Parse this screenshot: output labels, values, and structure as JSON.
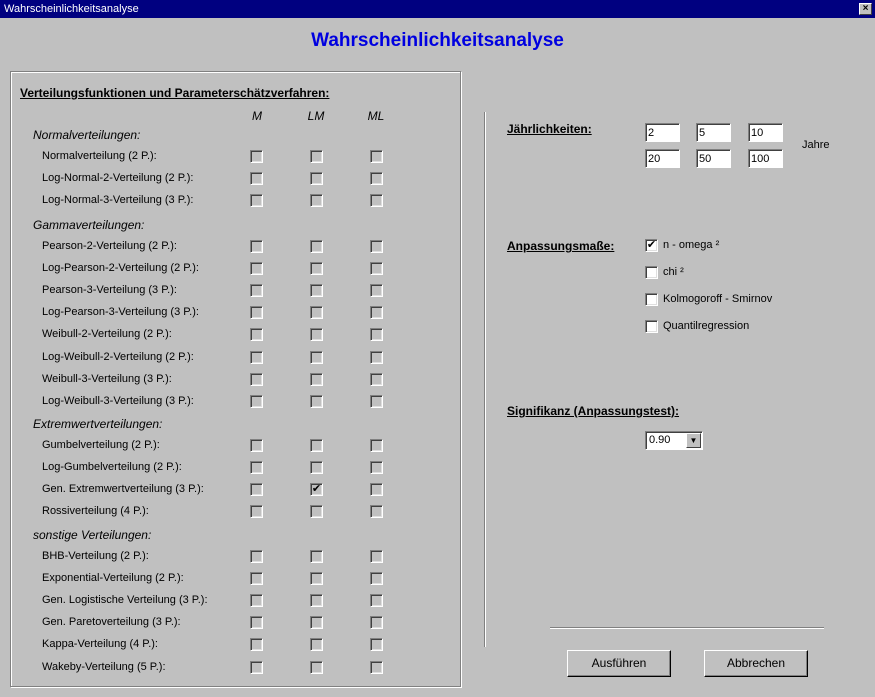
{
  "window": {
    "title": "Wahrscheinlichkeitsanalyse",
    "close_glyph": "×"
  },
  "header": {
    "title": "Wahrscheinlichkeitsanalyse"
  },
  "left": {
    "heading": "Verteilungsfunktionen und Parameterschätzverfahren:",
    "columns": [
      "M",
      "LM",
      "ML"
    ],
    "groups": [
      {
        "label": "Normalverteilungen:",
        "items": [
          {
            "label": "Normalverteilung (2 P.):",
            "checks": [
              false,
              false,
              false
            ]
          },
          {
            "label": "Log-Normal-2-Verteilung (2 P.):",
            "checks": [
              false,
              false,
              false
            ]
          },
          {
            "label": "Log-Normal-3-Verteilung (3 P.):",
            "checks": [
              false,
              false,
              false
            ]
          }
        ]
      },
      {
        "label": "Gammaverteilungen:",
        "items": [
          {
            "label": "Pearson-2-Verteilung (2 P.):",
            "checks": [
              false,
              false,
              false
            ]
          },
          {
            "label": "Log-Pearson-2-Verteilung (2 P.):",
            "checks": [
              false,
              false,
              false
            ]
          },
          {
            "label": "Pearson-3-Verteilung (3 P.):",
            "checks": [
              false,
              false,
              false
            ]
          },
          {
            "label": "Log-Pearson-3-Verteilung (3 P.):",
            "checks": [
              false,
              false,
              false
            ]
          },
          {
            "label": "Weibull-2-Verteilung (2 P.):",
            "checks": [
              false,
              false,
              false
            ]
          },
          {
            "label": "Log-Weibull-2-Verteilung (2 P.):",
            "checks": [
              false,
              false,
              false
            ]
          },
          {
            "label": "Weibull-3-Verteilung (3 P.):",
            "checks": [
              false,
              false,
              false
            ]
          },
          {
            "label": "Log-Weibull-3-Verteilung (3 P.):",
            "checks": [
              false,
              false,
              false
            ]
          }
        ]
      },
      {
        "label": "Extremwertverteilungen:",
        "items": [
          {
            "label": "Gumbelverteilung (2 P.):",
            "checks": [
              false,
              false,
              false
            ]
          },
          {
            "label": "Log-Gumbelverteilung (2 P.):",
            "checks": [
              false,
              false,
              false
            ]
          },
          {
            "label": "Gen. Extremwertverteilung (3 P.):",
            "checks": [
              false,
              true,
              false
            ]
          },
          {
            "label": "Rossiverteilung (4 P.):",
            "checks": [
              false,
              false,
              false
            ]
          }
        ]
      },
      {
        "label": "sonstige Verteilungen:",
        "items": [
          {
            "label": "BHB-Verteilung (2 P.):",
            "checks": [
              false,
              false,
              false
            ]
          },
          {
            "label": "Exponential-Verteilung (2 P.):",
            "checks": [
              false,
              false,
              false
            ]
          },
          {
            "label": "Gen. Logistische Verteilung (3 P.):",
            "checks": [
              false,
              false,
              false
            ]
          },
          {
            "label": "Gen. Paretoverteilung (3 P.):",
            "checks": [
              false,
              false,
              false
            ]
          },
          {
            "label": "Kappa-Verteilung (4 P.):",
            "checks": [
              false,
              false,
              false
            ]
          },
          {
            "label": "Wakeby-Verteilung (5 P.):",
            "checks": [
              false,
              false,
              false
            ]
          }
        ]
      }
    ]
  },
  "right": {
    "return_periods": {
      "heading": "Jährlichkeiten:",
      "values": [
        "2",
        "5",
        "10",
        "20",
        "50",
        "100"
      ],
      "unit": "Jahre"
    },
    "fit_measures": {
      "heading": "Anpassungsmaße:",
      "options": [
        {
          "label": "n - omega ²",
          "checked": true
        },
        {
          "label": "chi ²",
          "checked": false
        },
        {
          "label": "Kolmogoroff - Smirnov",
          "checked": false
        },
        {
          "label": "Quantilregression",
          "checked": false
        }
      ]
    },
    "significance": {
      "heading": "Signifikanz (Anpassungstest):",
      "selected": "0.90",
      "arrow_glyph": "▼"
    }
  },
  "footer": {
    "run_label": "Ausführen",
    "cancel_label": "Abbrechen"
  }
}
